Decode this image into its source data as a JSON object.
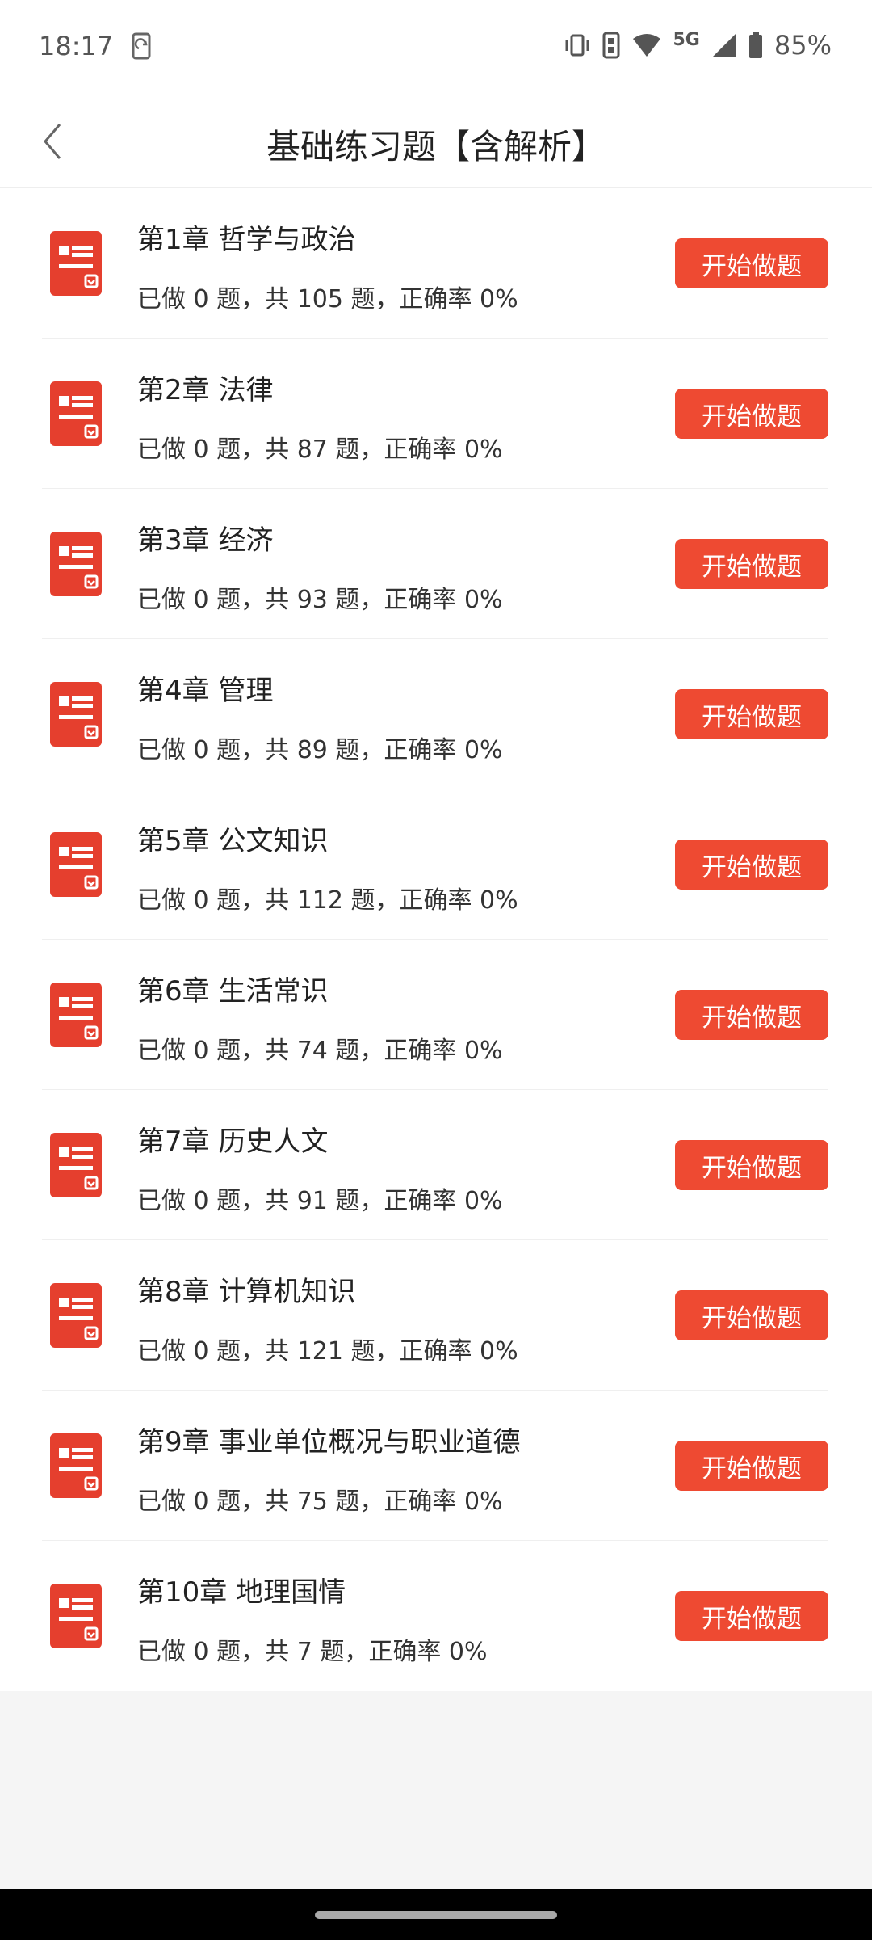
{
  "status_bar": {
    "time": "18:17",
    "network": "5G",
    "battery": "85%",
    "icons": [
      "screen-rotate-icon",
      "vibrate-icon",
      "hd-icon",
      "wifi-icon",
      "signal-icon",
      "battery-icon"
    ]
  },
  "header": {
    "title": "基础练习题【含解析】",
    "back_icon": "chevron-left-icon"
  },
  "colors": {
    "accent": "#ee4a32",
    "icon_red": "#e53f2e",
    "background": "#f5f5f5"
  },
  "chapters": [
    {
      "title": "第1章 哲学与政治",
      "stats": "已做 0 题，共 105 题，正确率 0%",
      "button": "开始做题"
    },
    {
      "title": "第2章 法律",
      "stats": "已做 0 题，共 87 题，正确率 0%",
      "button": "开始做题"
    },
    {
      "title": "第3章 经济",
      "stats": "已做 0 题，共 93 题，正确率 0%",
      "button": "开始做题"
    },
    {
      "title": "第4章 管理",
      "stats": "已做 0 题，共 89 题，正确率 0%",
      "button": "开始做题"
    },
    {
      "title": "第5章 公文知识",
      "stats": "已做 0 题，共 112 题，正确率 0%",
      "button": "开始做题"
    },
    {
      "title": "第6章 生活常识",
      "stats": "已做 0 题，共 74 题，正确率 0%",
      "button": "开始做题"
    },
    {
      "title": "第7章 历史人文",
      "stats": "已做 0 题，共 91 题，正确率 0%",
      "button": "开始做题"
    },
    {
      "title": "第8章 计算机知识",
      "stats": "已做 0 题，共 121 题，正确率 0%",
      "button": "开始做题"
    },
    {
      "title": "第9章 事业单位概况与职业道德",
      "stats": "已做 0 题，共 75 题，正确率 0%",
      "button": "开始做题"
    },
    {
      "title": "第10章 地理国情",
      "stats": "已做 0 题，共 7 题，正确率 0%",
      "button": "开始做题"
    }
  ]
}
